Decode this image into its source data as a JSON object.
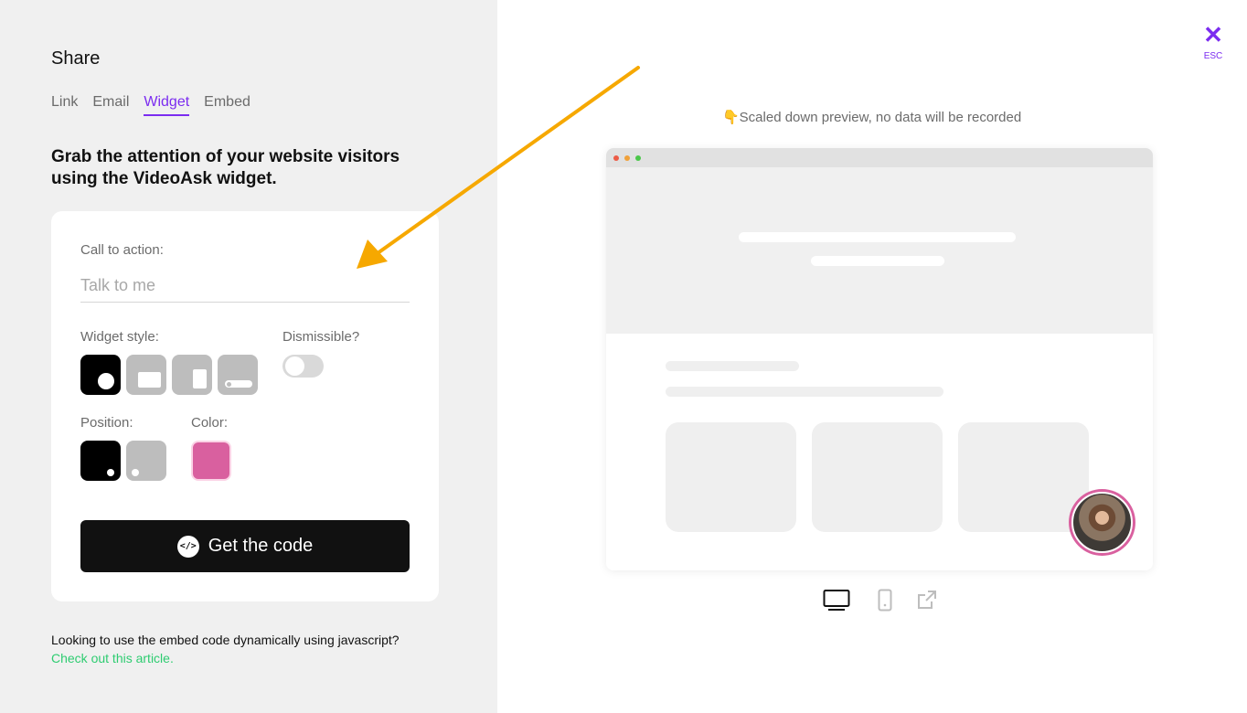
{
  "share": {
    "title": "Share",
    "tabs": [
      {
        "label": "Link",
        "active": false
      },
      {
        "label": "Email",
        "active": false
      },
      {
        "label": "Widget",
        "active": true
      },
      {
        "label": "Embed",
        "active": false
      }
    ],
    "headline": "Grab the attention of your website visitors using the VideoAsk widget."
  },
  "form": {
    "cta_label": "Call to action:",
    "cta_placeholder": "Talk to me",
    "widget_style_label": "Widget style:",
    "widget_styles": [
      "circle-bubble",
      "landscape-card",
      "portrait-card",
      "pill-bar"
    ],
    "widget_style_selected": "circle-bubble",
    "dismissible_label": "Dismissible?",
    "dismissible_on": false,
    "position_label": "Position:",
    "positions": [
      "bottom-right",
      "bottom-left"
    ],
    "position_selected": "bottom-right",
    "color_label": "Color:",
    "color_value": "#d9609f",
    "code_button_label": "Get the code",
    "code_icon": "code-icon"
  },
  "footer": {
    "text": "Looking to use the embed code dynamically using javascript?",
    "link": "Check out this article."
  },
  "close": {
    "icon": "close-icon",
    "esc_label": "ESC"
  },
  "preview": {
    "note": "👇Scaled down preview, no data will be recorded",
    "devices": [
      {
        "icon": "desktop-icon",
        "active": true
      },
      {
        "icon": "mobile-icon",
        "active": false
      },
      {
        "icon": "external-link-icon",
        "active": false
      }
    ]
  },
  "colors": {
    "accent": "#7b2cf0",
    "link": "#2ecc71",
    "widget": "#d9609f",
    "arrow": "#f6a800"
  }
}
